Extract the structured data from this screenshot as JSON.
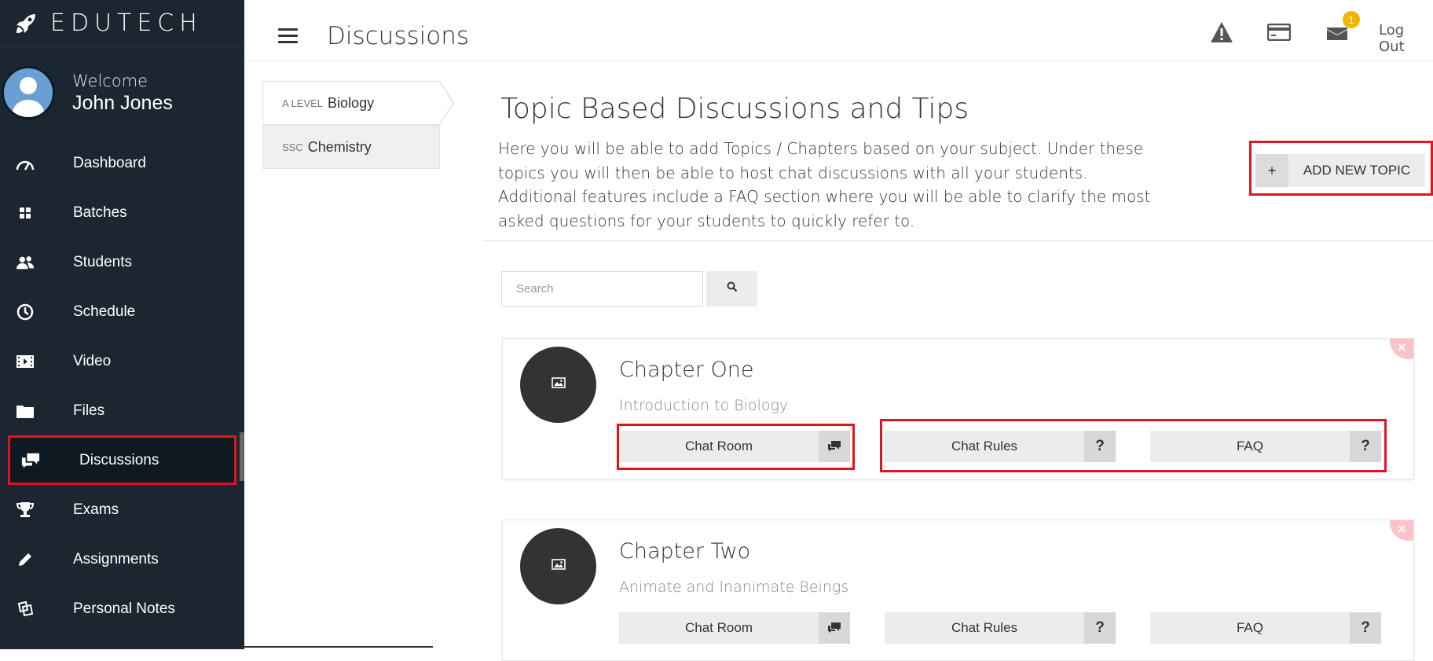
{
  "brand": {
    "name": "EDUTECH"
  },
  "profile": {
    "welcome": "Welcome",
    "name": "John Jones"
  },
  "sidebar": {
    "items": [
      {
        "label": "Dashboard",
        "icon": "speedometer-icon"
      },
      {
        "label": "Batches",
        "icon": "grid-icon"
      },
      {
        "label": "Students",
        "icon": "users-icon"
      },
      {
        "label": "Schedule",
        "icon": "clock-icon"
      },
      {
        "label": "Video",
        "icon": "film-icon"
      },
      {
        "label": "Files",
        "icon": "folder-icon"
      },
      {
        "label": "Discussions",
        "icon": "chat-icon",
        "active": true
      },
      {
        "label": "Exams",
        "icon": "trophy-icon"
      },
      {
        "label": "Assignments",
        "icon": "pencil-icon"
      },
      {
        "label": "Personal Notes",
        "icon": "notes-icon"
      }
    ]
  },
  "header": {
    "title": "Discussions",
    "logout": "Log Out",
    "mail_badge": "1"
  },
  "subjects": [
    {
      "level": "A LEVEL",
      "name": "Biology",
      "active": true
    },
    {
      "level": "SSC",
      "name": "Chemistry"
    }
  ],
  "content": {
    "title": "Topic Based Discussions and Tips",
    "description": "Here you will be able to add Topics / Chapters based on your subject. Under these topics you will then be able to host chat discussions with all your students. Additional features include a FAQ section where you will be able to clarify the most asked questions for your students to quickly refer to.",
    "add_topic_label": "ADD NEW TOPIC",
    "add_topic_plus": "+",
    "search_placeholder": "Search"
  },
  "topics": [
    {
      "title": "Chapter One",
      "subtitle": "Introduction to Biology",
      "chat_room": "Chat Room",
      "chat_rules": "Chat Rules",
      "faq": "FAQ",
      "q": "?"
    },
    {
      "title": "Chapter Two",
      "subtitle": "Animate and Inanimate Beings",
      "chat_room": "Chat Room",
      "chat_rules": "Chat Rules",
      "faq": "FAQ",
      "q": "?"
    }
  ],
  "colors": {
    "sidebar_bg": "#1b2631",
    "highlight": "#e0141e",
    "badge": "#f5b400",
    "avatar": "#6a9fd3"
  }
}
